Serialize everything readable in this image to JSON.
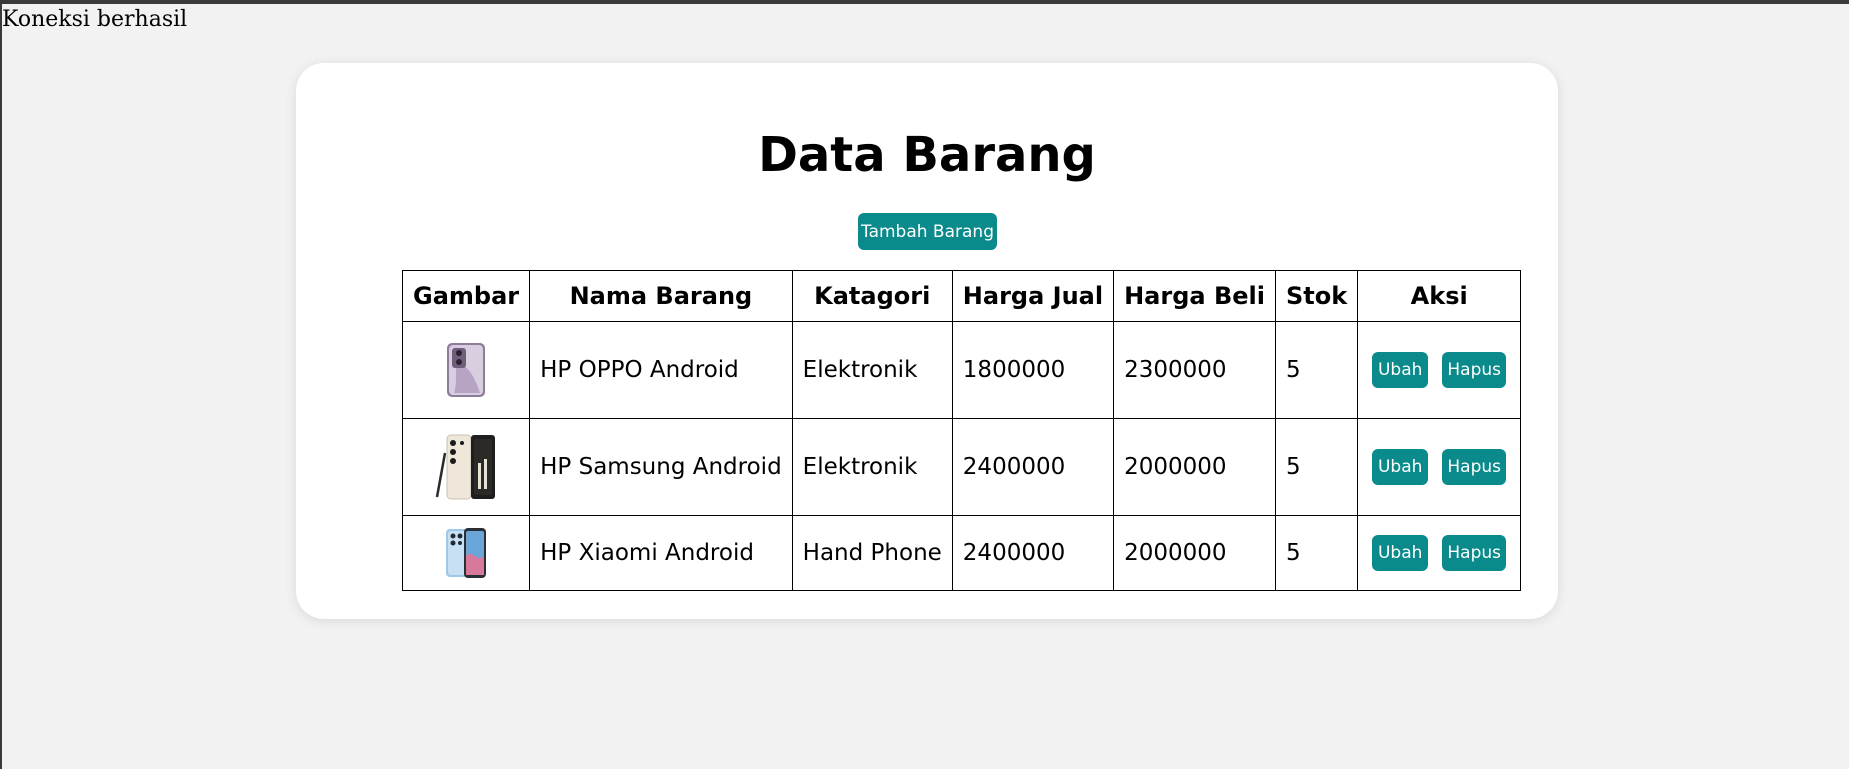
{
  "status": "Koneksi berhasil",
  "page_title": "Data Barang",
  "add_button_label": "Tambah Barang",
  "accent_color": "#0a8a8a",
  "table": {
    "headers": [
      "Gambar",
      "Nama Barang",
      "Katagori",
      "Harga Jual",
      "Harga Beli",
      "Stok",
      "Aksi"
    ],
    "rows": [
      {
        "image_icon": "oppo-phone-image",
        "nama_barang": "HP OPPO Android",
        "katagori": "Elektronik",
        "harga_jual": "1800000",
        "harga_beli": "2300000",
        "stok": "5",
        "edit_label": "Ubah",
        "delete_label": "Hapus"
      },
      {
        "image_icon": "samsung-phone-image",
        "nama_barang": "HP Samsung Android",
        "katagori": "Elektronik",
        "harga_jual": "2400000",
        "harga_beli": "2000000",
        "stok": "5",
        "edit_label": "Ubah",
        "delete_label": "Hapus"
      },
      {
        "image_icon": "xiaomi-phone-image",
        "nama_barang": "HP Xiaomi Android",
        "katagori": "Hand Phone",
        "harga_jual": "2400000",
        "harga_beli": "2000000",
        "stok": "5",
        "edit_label": "Ubah",
        "delete_label": "Hapus"
      }
    ]
  }
}
